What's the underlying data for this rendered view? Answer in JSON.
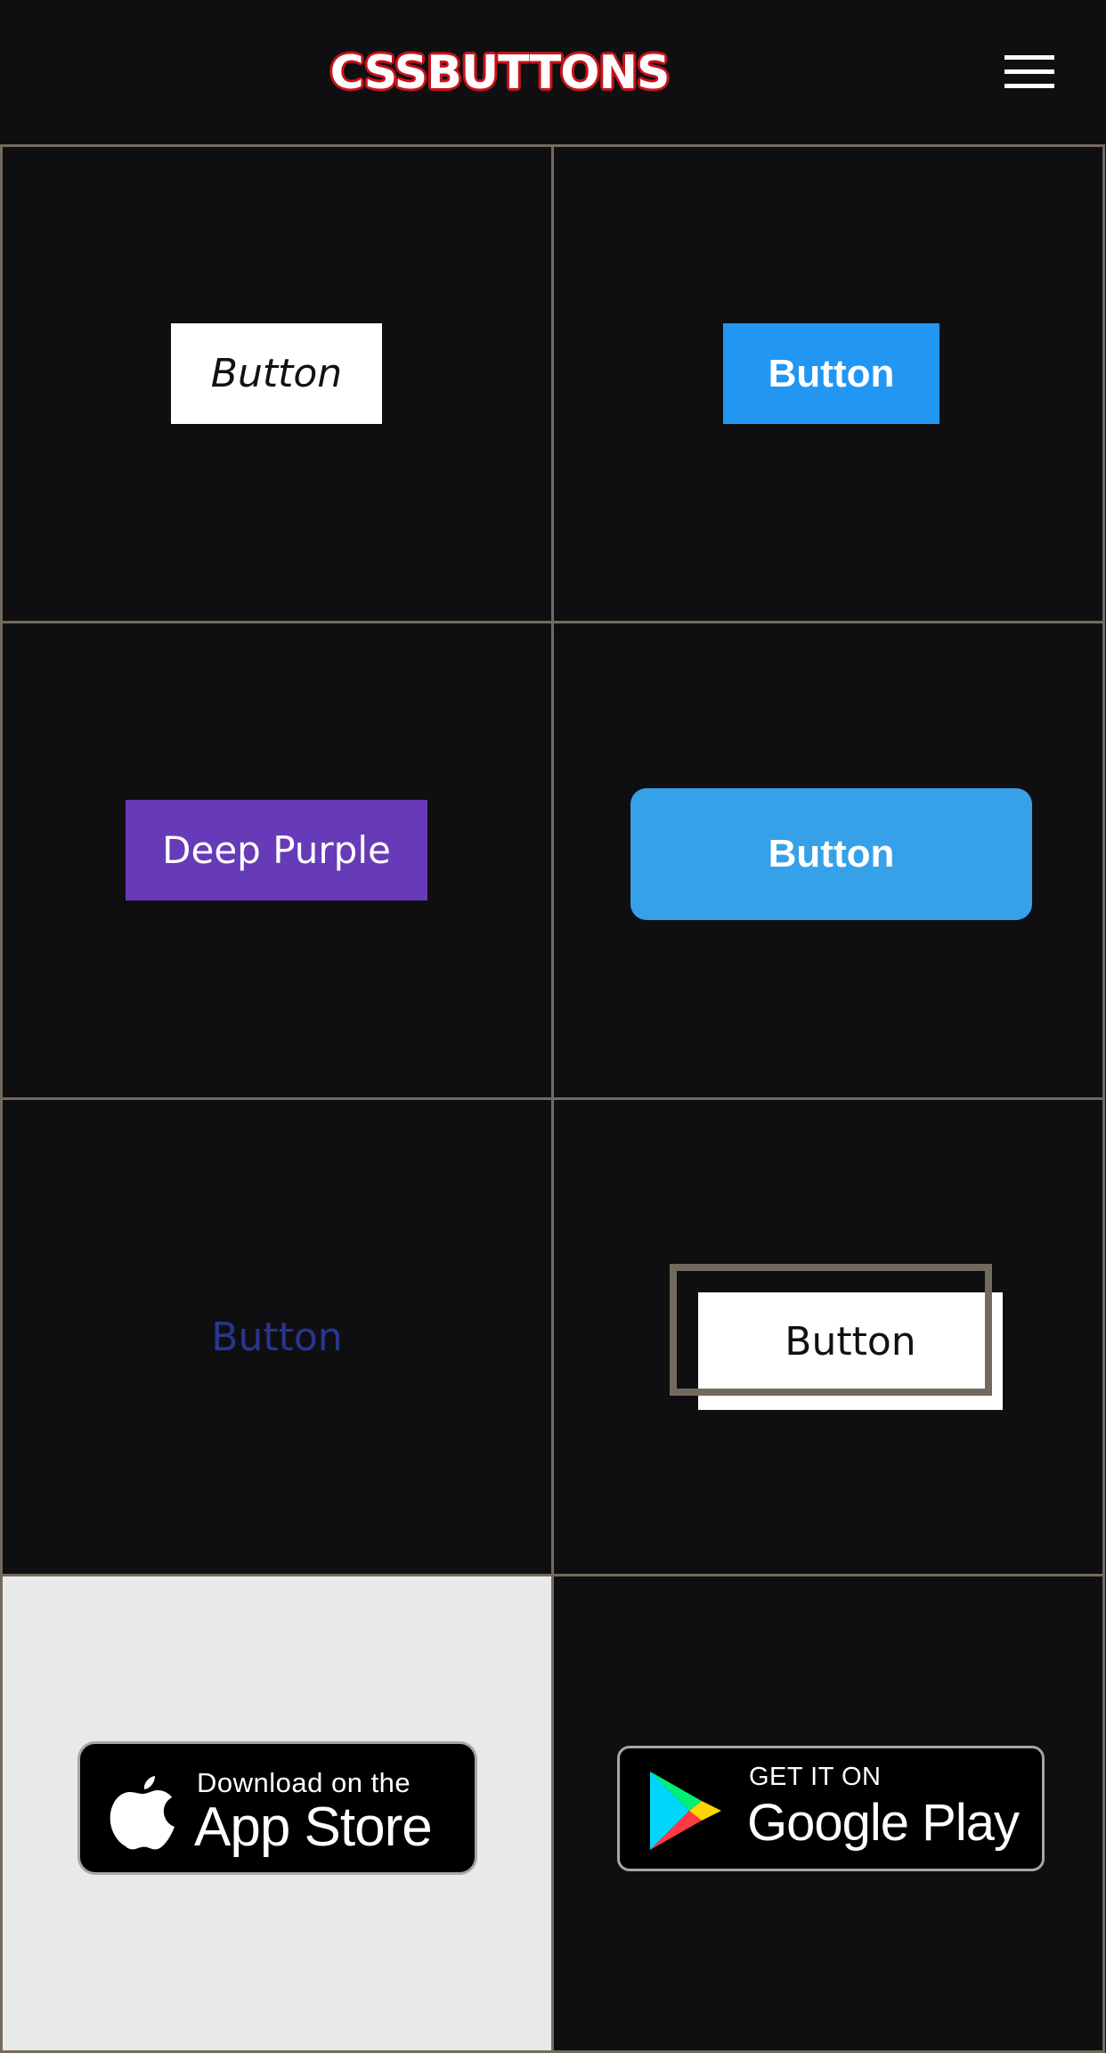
{
  "header": {
    "logo_text": "CSSBUTTONS",
    "menu_icon": "hamburger-menu-icon"
  },
  "buttons": {
    "italic_white": "Button",
    "blue_flat": "Button",
    "deep_purple": "Deep Purple",
    "blue_rounded": "Button",
    "text_link": "Button",
    "offset_frame": "Button"
  },
  "badges": {
    "app_store": {
      "small": "Download on the",
      "big": "App Store",
      "icon": "apple-icon"
    },
    "google_play": {
      "small": "GET IT ON",
      "big": "Google Play",
      "icon": "google-play-icon"
    }
  },
  "colors": {
    "page_bg": "#0f0f12",
    "grid_border": "#736a5f",
    "logo_outline": "#c8121b",
    "blue_flat": "#2196f3",
    "deep_purple": "#673ab7",
    "blue_rounded": "#36a1e8",
    "text_link": "#2a3590"
  }
}
